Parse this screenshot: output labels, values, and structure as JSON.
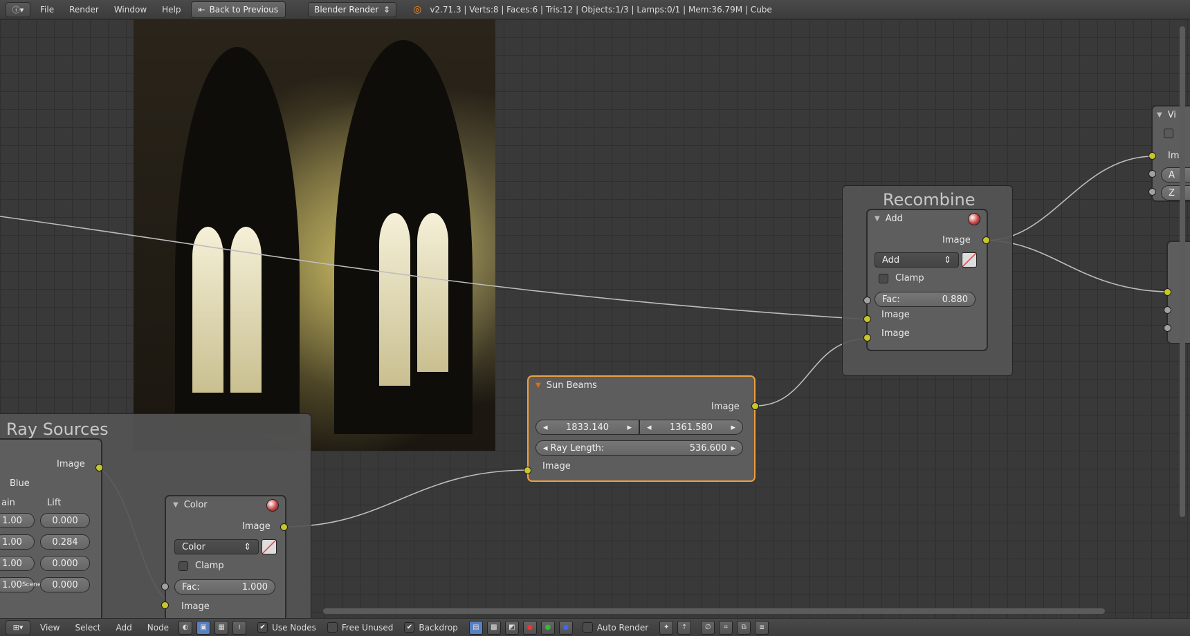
{
  "top_bar": {
    "editor_icon": "info-icon",
    "menus": [
      "File",
      "Render",
      "Window",
      "Help"
    ],
    "back_button": "Back to Previous",
    "engine": "Blender Render",
    "stats": "v2.71.3 | Verts:8 | Faces:6 | Tris:12 | Objects:1/3 | Lamps:0/1 | Mem:36.79M | Cube"
  },
  "frames": {
    "ray_sources": "Ray Sources",
    "recombine": "Recombine"
  },
  "nodes": {
    "sun_beams": {
      "title": "Sun Beams",
      "out_image": "Image",
      "source_x": "1833.140",
      "source_y": "1361.580",
      "ray_length_label": "Ray Length:",
      "ray_length_value": "536.600",
      "in_image": "Image"
    },
    "add": {
      "title": "Add",
      "out_image": "Image",
      "blend_mode": "Add",
      "clamp": "Clamp",
      "fac_label": "Fac:",
      "fac_value": "0.880",
      "in_image_1": "Image",
      "in_image_2": "Image"
    },
    "color": {
      "title": "Color",
      "out_image": "Image",
      "blend_mode": "Color",
      "clamp": "Clamp",
      "fac_label": "Fac:",
      "fac_value": "1.000",
      "in_image": "Image"
    },
    "color_balance": {
      "out_image": "Image",
      "channel": "Blue",
      "gain_label": "ain",
      "lift_label": "Lift",
      "gain_values": [
        "1.00",
        "1.00",
        "1.00",
        "1.00"
      ],
      "lift_values": [
        "0.000",
        "0.284",
        "0.000",
        "0.000"
      ],
      "scene_tag": "Scene"
    },
    "viewer_partial": {
      "title": "Vi",
      "image": "Ima",
      "a": "A",
      "z": "Z"
    }
  },
  "bottom_bar": {
    "menus": [
      "View",
      "Select",
      "Add",
      "Node"
    ],
    "use_nodes": "Use Nodes",
    "free_unused": "Free Unused",
    "backdrop": "Backdrop",
    "auto_render": "Auto Render"
  },
  "colors": {
    "socket_yellow": "#c7c729",
    "active_border": "#f0a040",
    "canvas": "#393939"
  }
}
